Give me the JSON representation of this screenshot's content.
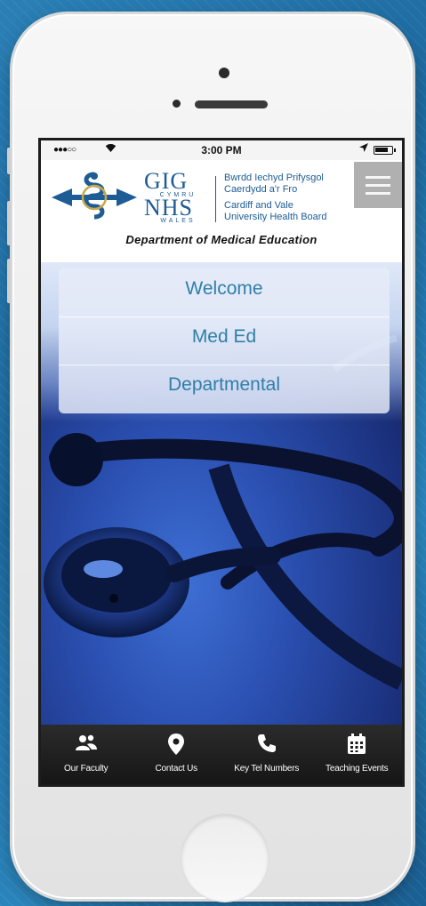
{
  "status_bar": {
    "signal": "●●●○○",
    "time": "3:00 PM"
  },
  "header": {
    "gig": "GIG",
    "cymru": "CYMRU",
    "nhs": "NHS",
    "wales": "WALES",
    "board_line_1": "Bwrdd Iechyd Prifysgol",
    "board_line_2": "Caerdydd a'r Fro",
    "board_line_3": "Cardiff and Vale",
    "board_line_4": "University Health Board",
    "department": "Department of Medical Education"
  },
  "nav": [
    {
      "label": "Welcome"
    },
    {
      "label": "Med Ed"
    },
    {
      "label": "Departmental"
    }
  ],
  "tabs": [
    {
      "label": "Our Faculty",
      "icon": "users-icon"
    },
    {
      "label": "Contact Us",
      "icon": "location-pin-icon"
    },
    {
      "label": "Key Tel Numbers",
      "icon": "phone-icon"
    },
    {
      "label": "Teaching Events",
      "icon": "calendar-icon"
    }
  ],
  "colors": {
    "brand_blue": "#1d5c95",
    "link_teal": "#2f7fa8",
    "hero_blue": "#2a4fb0",
    "tab_bar": "#1a1a1a"
  }
}
